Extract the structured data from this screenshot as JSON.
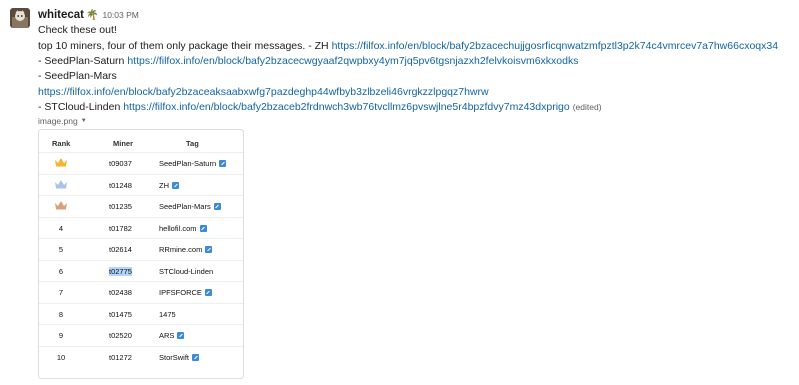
{
  "message": {
    "username": "whitecat",
    "status_emoji": "🌴",
    "time": "10:03 PM",
    "lines": [
      {
        "text": "Check these out!",
        "link": ""
      },
      {
        "text": " top 10 miners, four of them only package their messages.  -  ZH ",
        "link": "https://filfox.info/en/block/bafy2bzacechujjgosrficqnwatzmfpztl3p2k74c4vmrcev7a7hw66cxoqx34"
      },
      {
        "text": "- SeedPlan-Saturn ",
        "link": "https://filfox.info/en/block/bafy2bzacecwgyaaf2qwpbxy4ym7jq5pv6tgsnjazxh2felvkoisvm6xkxodks"
      },
      {
        "text": "- SeedPlan-Mars",
        "link": ""
      },
      {
        "text": "",
        "link": "https://filfox.info/en/block/bafy2bzaceaksaabxwfg7pazdeghp44wfbyb3zlbzeli46vrgkzzlpgqz7hwrw"
      },
      {
        "text": "-  STCloud-Linden ",
        "link": "https://filfox.info/en/block/bafy2bzaceb2frdnwch3wb76tvcllmz6pvswjlne5r4bpzfdvy7mz43dxprigo",
        "edited": "(edited)"
      }
    ]
  },
  "attachment": {
    "filename": "image.png",
    "table": {
      "headers": [
        "Rank",
        "Miner",
        "Tag"
      ],
      "rows": [
        {
          "rank": "",
          "crown": "gold",
          "miner": "t09037",
          "tag": "SeedPlan-Saturn",
          "icon": true
        },
        {
          "rank": "",
          "crown": "silver",
          "miner": "t01248",
          "tag": "ZH",
          "icon": true
        },
        {
          "rank": "",
          "crown": "bronze",
          "miner": "t01235",
          "tag": "SeedPlan-Mars",
          "icon": true
        },
        {
          "rank": "4",
          "crown": "",
          "miner": "t01782",
          "tag": "hellofil.com",
          "icon": true
        },
        {
          "rank": "5",
          "crown": "",
          "miner": "t02614",
          "tag": "RRmine.com",
          "icon": true
        },
        {
          "rank": "6",
          "crown": "",
          "miner": "t02775",
          "tag": "STCloud-Linden",
          "icon": false,
          "selected": true
        },
        {
          "rank": "7",
          "crown": "",
          "miner": "t02438",
          "tag": "IPFSFORCE",
          "icon": true
        },
        {
          "rank": "8",
          "crown": "",
          "miner": "t01475",
          "tag": "1475",
          "icon": false
        },
        {
          "rank": "9",
          "crown": "",
          "miner": "t02520",
          "tag": "ARS",
          "icon": true
        },
        {
          "rank": "10",
          "crown": "",
          "miner": "t01272",
          "tag": "StorSwift",
          "icon": true
        }
      ]
    }
  },
  "colors": {
    "link": "#1264a3",
    "crown_gold": "#f2b632",
    "crown_silver": "#a9c4e0",
    "crown_bronze": "#d9a07a",
    "selection": "#b3d4fc"
  }
}
